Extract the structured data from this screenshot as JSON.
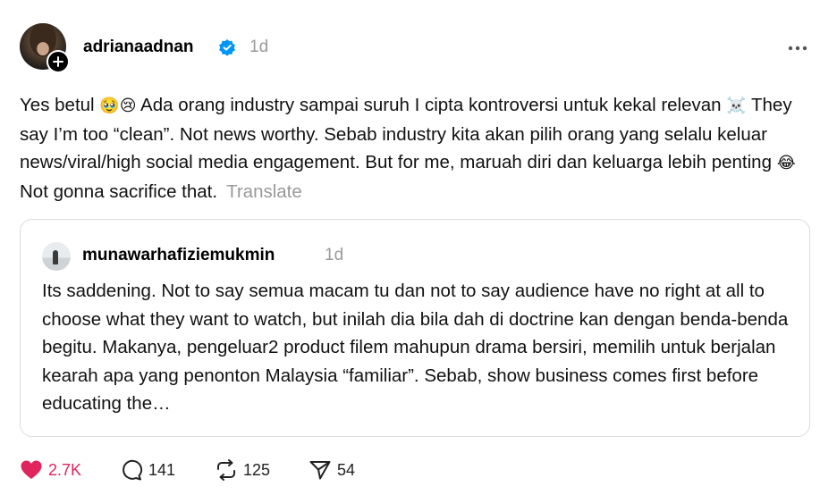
{
  "post": {
    "username": "adrianaadnan",
    "time": "1d",
    "body_parts": {
      "p1": "Yes betul ",
      "e1": "🥹😢",
      "p2": " Ada orang industry sampai suruh I cipta kontroversi untuk kekal relevan ",
      "e2": "☠️",
      "p3": " They say I’m too “clean”. Not news worthy. Sebab industry kita akan pilih orang yang selalu keluar news/viral/high social media engagement. But for me, maruah diri dan keluarga lebih penting ",
      "e3": "😂",
      "p4": " Not gonna sacrifice that."
    },
    "translate_label": "Translate"
  },
  "quote": {
    "username": "munawarhafiziemukmin",
    "time": "1d",
    "body": "Its saddening. Not to say semua macam tu dan not to say audience have no right at all to choose what they want to watch, but inilah dia bila dah di doctrine kan dengan benda-benda begitu. Makanya, pengeluar2 product filem mahupun drama bersiri, memilih untuk berjalan kearah apa yang penonton Malaysia “familiar”. Sebab, show business comes first before educating the…"
  },
  "actions": {
    "likes": "2.7K",
    "comments": "141",
    "reposts": "125",
    "shares": "54"
  },
  "colors": {
    "like": "#e0245e",
    "verified": "#0095f6",
    "muted": "#9a9a9a"
  }
}
